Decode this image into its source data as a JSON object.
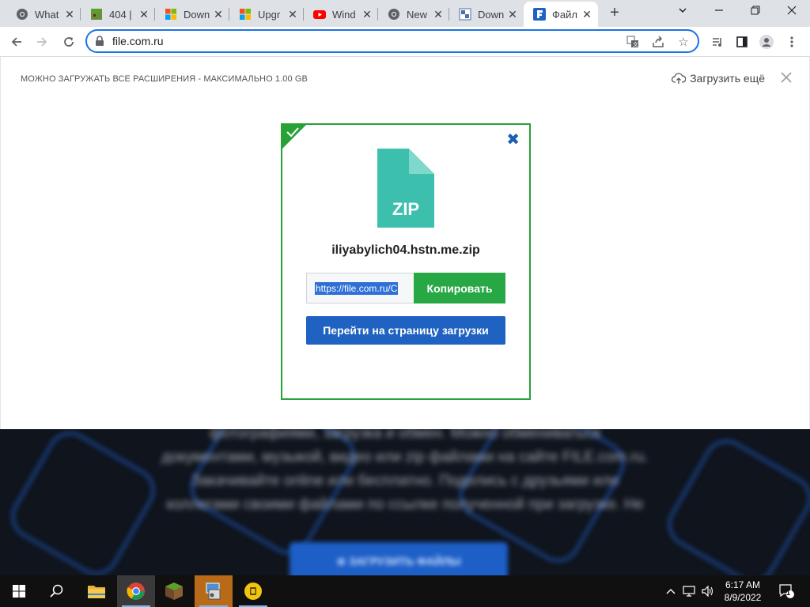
{
  "browser": {
    "tabs": [
      {
        "label": "What",
        "icon": "chrome-icon"
      },
      {
        "label": "404 |",
        "icon": "minecraft-icon"
      },
      {
        "label": "Down",
        "icon": "microsoft-icon"
      },
      {
        "label": "Upgr",
        "icon": "microsoft-icon"
      },
      {
        "label": "Wind",
        "icon": "youtube-icon"
      },
      {
        "label": "New",
        "icon": "chrome-icon"
      },
      {
        "label": "Down",
        "icon": "softonic-icon"
      },
      {
        "label": "Файл",
        "icon": "filecom-icon",
        "active": true
      }
    ],
    "url": "file.com.ru"
  },
  "upload_panel": {
    "notice": "МОЖНО ЗАГРУЖАТЬ ВСЕ РАСШИРЕНИЯ - МАКСИМАЛЬНО 1.00 GB",
    "upload_more": "Загрузить ещё"
  },
  "file_card": {
    "file_type": "ZIP",
    "file_name": "iliyabylich04.hstn.me.zip",
    "link_value": "https://file.com.ru/C",
    "copy_label": "Копировать",
    "goto_label": "Перейти на страницу загрузки",
    "success_color": "#28a137"
  },
  "background_page": {
    "text_lines": [
      "фотографиями, загрузка и обмен. Можно обмениваться",
      "документами, музыкой, видео или zip файлами на сайте FILE.com.ru.",
      "Закачивайте online или бесплатно. Поделись с друзьями или",
      "коллегами своими файлами по ссылке полученной при загрузке. Не"
    ],
    "button_label": "⊕ ЗАГРУЗИТЬ ФАЙЛЫ"
  },
  "taskbar": {
    "time": "6:17 AM",
    "date": "8/9/2022",
    "notification_count": "1"
  }
}
